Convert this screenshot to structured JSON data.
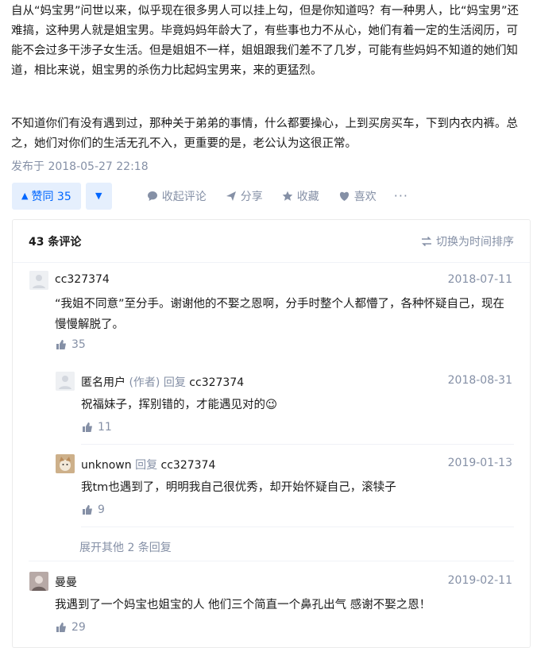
{
  "article": {
    "paragraph1": "自从“妈宝男”问世以来，似乎现在很多男人可以挂上勾，但是你知道吗？有一种男人，比“妈宝男”还难搞，这种男人就是姐宝男。毕竟妈妈年龄大了，有些事也力不从心，她们有着一定的生活阅历，可能不会过多干涉子女生活。但是姐姐不一样，姐姐跟我们差不了几岁，可能有些妈妈不知道的她们知道，相比来说，姐宝男的杀伤力比起妈宝男来，来的更猛烈。",
    "paragraph2": "不知道你们有没有遇到过，那种关于弟弟的事情，什么都要操心，上到买房买车，下到内衣内裤。总之，她们对你们的生活无孔不入，更重要的是，老公认为这很正常。",
    "published": "发布于 2018-05-27 22:18"
  },
  "actions": {
    "upvote_label": "赞同 35",
    "comment_label": "收起评论",
    "share_label": "分享",
    "collect_label": "收藏",
    "like_label": "喜欢",
    "more_label": "···"
  },
  "comments": {
    "count_label": "43 条评论",
    "sort_label": "切换为时间排序",
    "items": [
      {
        "user": "cc327374",
        "date": "2018-07-11",
        "text": "“我姐不同意”至分手。谢谢他的不娶之恩啊，分手时整个人都懵了，各种怀疑自己，现在慢慢解脱了。",
        "likes": "35"
      },
      {
        "user": "匿名用户",
        "author_tag": "(作者)",
        "reply_word": "回复",
        "reply_to": "cc327374",
        "date": "2018-08-31",
        "text": "祝福妹子，挥别错的，才能遇见对的😉",
        "likes": "11"
      },
      {
        "user": "unknown",
        "reply_word": "回复",
        "reply_to": "cc327374",
        "date": "2019-01-13",
        "text": "我tm也遇到了，明明我自己很优秀，却开始怀疑自己，滚犊子",
        "likes": "9"
      },
      {
        "user": "曼曼",
        "date": "2019-02-11",
        "text": "我遇到了一个妈宝也姐宝的人 他们三个简直一个鼻孔出气 感谢不娶之恩！",
        "likes": "29"
      }
    ],
    "expand_label": "展开其他 2 条回复"
  },
  "colors": {
    "accent": "#0066ff",
    "accent_bg": "#e5effd",
    "muted": "#8590a6"
  }
}
